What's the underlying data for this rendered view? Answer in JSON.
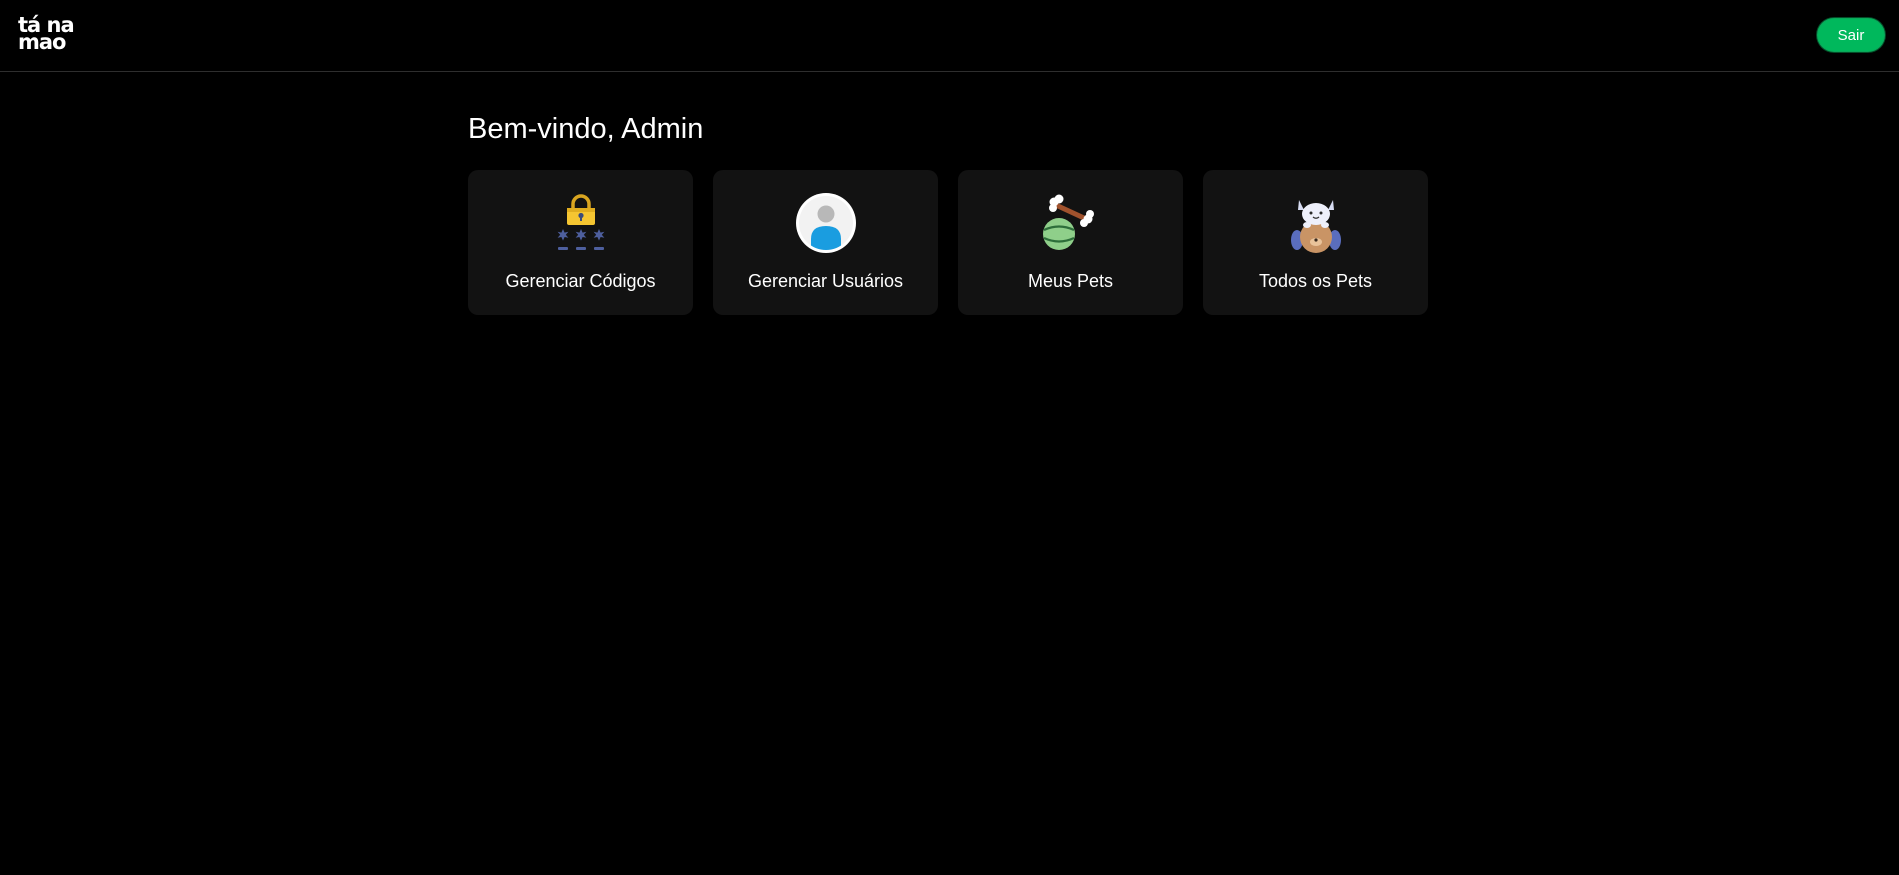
{
  "header": {
    "logo_line1": "tá na",
    "logo_line2": "mao",
    "logout_label": "Sair"
  },
  "main": {
    "welcome": "Bem-vindo, Admin",
    "cards": [
      {
        "label": "Gerenciar Códigos",
        "icon": "lock-password-icon"
      },
      {
        "label": "Gerenciar Usuários",
        "icon": "user-avatar-icon"
      },
      {
        "label": "Meus Pets",
        "icon": "pet-toys-icon"
      },
      {
        "label": "Todos os Pets",
        "icon": "cat-dog-icon"
      }
    ]
  },
  "colors": {
    "background": "#000000",
    "card_background": "#121212",
    "accent_green": "#00b85c",
    "text": "#ffffff"
  }
}
